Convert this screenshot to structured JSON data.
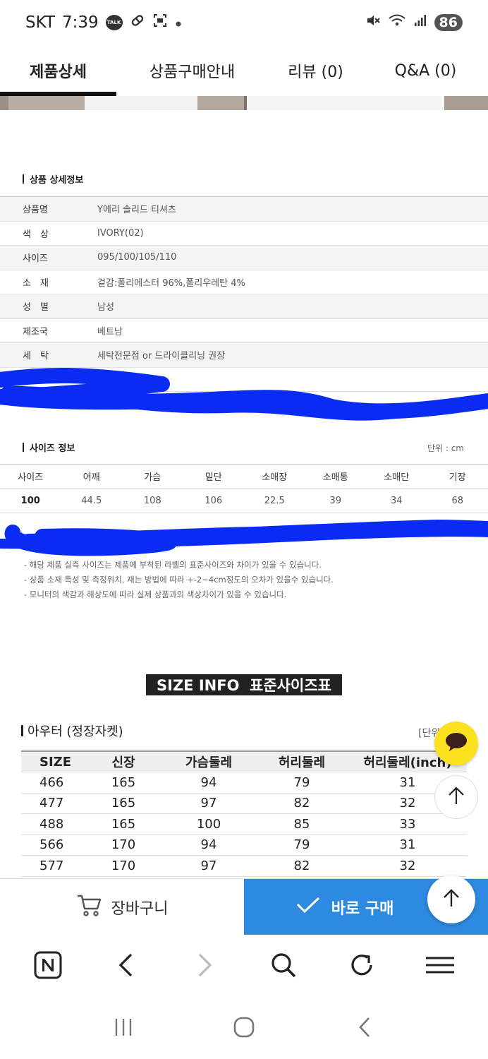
{
  "status_bar": {
    "carrier": "SKT",
    "time": "7:39",
    "talk_badge": "TALK",
    "battery": "86"
  },
  "tabs": [
    {
      "label": "제품상세",
      "active": true
    },
    {
      "label": "상품구매안내",
      "active": false
    },
    {
      "label": "리뷰 (0)",
      "active": false
    },
    {
      "label": "Q&A (0)",
      "active": false
    }
  ],
  "detail_section": {
    "title": "상품 상세정보",
    "rows": [
      {
        "key": "상품명",
        "value": "Y에리 솔리드 티셔츠"
      },
      {
        "key": "색　상",
        "value": "IVORY(02)"
      },
      {
        "key": "사이즈",
        "value": "095/100/105/110"
      },
      {
        "key": "소　재",
        "value": "겉감:폴리에스터 96%,폴리우레탄 4%"
      },
      {
        "key": "성　별",
        "value": "남성"
      },
      {
        "key": "제조국",
        "value": "베트남"
      },
      {
        "key": "세　탁",
        "value": "세탁전문점 or 드라이클리닝 권장"
      },
      {
        "key": "",
        "value": ""
      }
    ]
  },
  "size_section": {
    "title": "사이즈 정보",
    "unit": "단위 : cm",
    "headers": [
      "사이즈",
      "어깨",
      "가슴",
      "밑단",
      "소매장",
      "소매통",
      "소매단",
      "기장"
    ],
    "rows": [
      [
        "100",
        "44.5",
        "108",
        "106",
        "22.5",
        "39",
        "34",
        "68"
      ]
    ]
  },
  "notes": [
    "- 해당 제품 실측 사이즈는 제품에 부착된 라벨의 표준사이즈와 차이가 있을 수 있습니다.",
    "- 상품 소재 특성 및 측정위치, 재는 방법에 따라 +-2~4cm정도의 오차가 있을수 있습니다.",
    "- 모니터의 색감과 해상도에 따라 실제 상품과의 색상차이가 있을 수 있습니다."
  ],
  "size_info": {
    "title": "SIZE INFO  표준사이즈표",
    "outer_title": "아우터 (정장자켓)",
    "outer_unit": "[단위",
    "headers": [
      "SIZE",
      "신장",
      "가슴둘레",
      "허리둘레",
      "허리둘레(inch)"
    ],
    "rows": [
      [
        "466",
        "165",
        "94",
        "79",
        "31"
      ],
      [
        "477",
        "165",
        "97",
        "82",
        "32"
      ],
      [
        "488",
        "165",
        "100",
        "85",
        "33"
      ],
      [
        "566",
        "170",
        "94",
        "79",
        "31"
      ],
      [
        "577",
        "170",
        "97",
        "82",
        "32"
      ]
    ]
  },
  "buy_bar": {
    "cart_label": "장바구니",
    "buy_label": "바로 구매"
  },
  "colors": {
    "buy_blue": "#2e8ae0",
    "chat_yellow": "#fce11f",
    "scribble_blue": "#0a2cf2"
  }
}
